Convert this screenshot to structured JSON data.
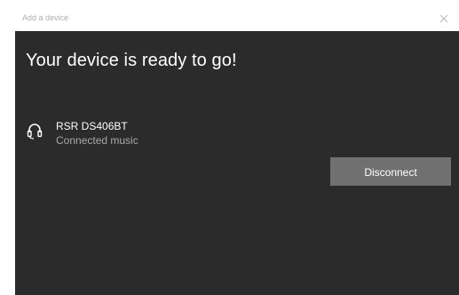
{
  "window": {
    "title": "Add a device",
    "close_glyph": "×"
  },
  "main": {
    "heading": "Your device is ready to go!"
  },
  "device": {
    "icon": "headset-icon",
    "name": "RSR DS406BT",
    "status": "Connected music"
  },
  "actions": {
    "disconnect_label": "Disconnect"
  },
  "colors": {
    "background": "#2b2b2b",
    "titlebar": "#ffffff",
    "button": "#707070",
    "text_primary": "#ffffff",
    "text_secondary": "#a8a8a8"
  }
}
